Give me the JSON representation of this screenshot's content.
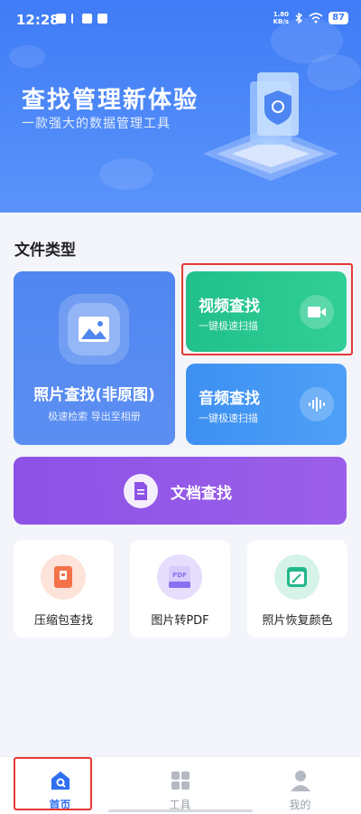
{
  "status_bar": {
    "time": "12:28",
    "net_speed_top": "1.80",
    "net_speed_bottom": "KB/s",
    "battery": "87"
  },
  "hero": {
    "title": "查找管理新体验",
    "subtitle": "一款强大的数据管理工具"
  },
  "section": {
    "title": "文件类型"
  },
  "cards": {
    "photo": {
      "title": "照片查找(非原图)",
      "subtitle": "极速检索 导出至相册",
      "icon": "image-icon"
    },
    "video": {
      "title": "视频查找",
      "subtitle": "一键极速扫描",
      "icon": "video-camera-icon"
    },
    "audio": {
      "title": "音频查找",
      "subtitle": "一键极速扫描",
      "icon": "audio-wave-icon"
    },
    "doc": {
      "title": "文档查找",
      "icon": "document-icon"
    }
  },
  "tools": [
    {
      "label": "压缩包查找",
      "icon": "zip-icon",
      "color": "#f4724a"
    },
    {
      "label": "图片转PDF",
      "icon": "pdf-icon",
      "color": "#8b6ff0",
      "badge": "PDF"
    },
    {
      "label": "照片恢复颜色",
      "icon": "photo-restore-icon",
      "color": "#23b88a"
    }
  ],
  "nav": {
    "home": "首页",
    "tools": "工具",
    "mine": "我的"
  },
  "colors": {
    "primary": "#2f6ff0",
    "video": "#22c08a",
    "audio": "#3d90f2",
    "doc": "#8d52e6",
    "highlight": "#e53935"
  }
}
